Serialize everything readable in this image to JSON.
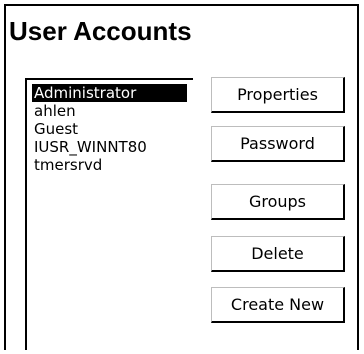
{
  "window": {
    "title": "User Accounts"
  },
  "accounts": {
    "items": [
      {
        "label": "Administrator",
        "selected": true
      },
      {
        "label": "ahlen",
        "selected": false
      },
      {
        "label": "Guest",
        "selected": false
      },
      {
        "label": "IUSR_WINNT80",
        "selected": false
      },
      {
        "label": "tmersrvd",
        "selected": false
      }
    ]
  },
  "buttons": {
    "properties": "Properties",
    "password": "Password",
    "groups": "Groups",
    "delete": "Delete",
    "create_new": "Create New"
  },
  "colors": {
    "selection_background": "#000000",
    "selection_text": "#ffffff",
    "button_shadow": "#000000"
  }
}
